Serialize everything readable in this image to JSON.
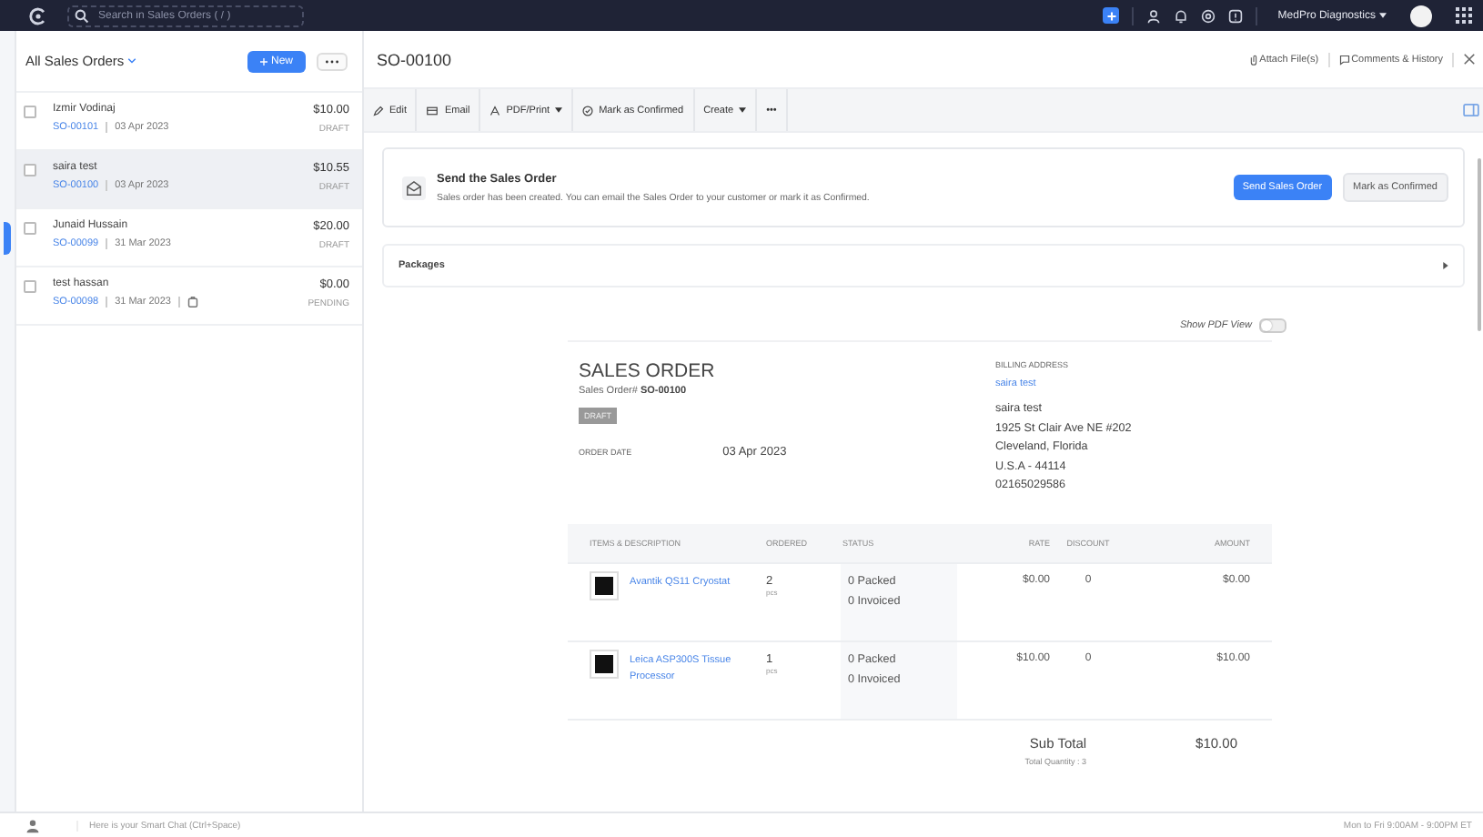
{
  "topbar": {
    "search_placeholder": "Search in Sales Orders ( / )",
    "org": "MedPro Diagnostics"
  },
  "list": {
    "title": "All Sales Orders",
    "new_button": "New",
    "orders": [
      {
        "name": "Izmir Vodinaj",
        "number": "SO-00101",
        "date": "03 Apr 2023",
        "amount": "$10.00",
        "status": "DRAFT",
        "selected": false,
        "attachment": false
      },
      {
        "name": "saira test",
        "number": "SO-00100",
        "date": "03 Apr 2023",
        "amount": "$10.55",
        "status": "DRAFT",
        "selected": true,
        "attachment": false
      },
      {
        "name": "Junaid Hussain",
        "number": "SO-00099",
        "date": "31 Mar 2023",
        "amount": "$20.00",
        "status": "DRAFT",
        "selected": false,
        "attachment": false
      },
      {
        "name": "test hassan",
        "number": "SO-00098",
        "date": "31 Mar 2023",
        "amount": "$0.00",
        "status": "PENDING",
        "selected": false,
        "attachment": true
      }
    ]
  },
  "detail": {
    "title": "SO-00100",
    "attach": "Attach File(s)",
    "comments": "Comments & History",
    "toolbar": [
      {
        "label": "Edit",
        "kind": "edit"
      },
      {
        "label": "Email",
        "kind": "email"
      },
      {
        "label": "PDF/Print",
        "kind": "pdf"
      },
      {
        "label": "Mark as Confirmed",
        "kind": "confirm"
      },
      {
        "label": "Create",
        "kind": "create"
      },
      {
        "label": "•••",
        "kind": "more"
      }
    ],
    "banner": {
      "title": "Send the Sales Order",
      "text": "Sales order has been created. You can email the Sales Order to your customer or mark it as Confirmed.",
      "primary": "Send Sales Order",
      "secondary": "Mark as Confirmed"
    },
    "packages": "Packages",
    "pdf_toggle": {
      "label": "Show PDF View",
      "on": false
    },
    "document": {
      "heading": "SALES ORDER",
      "number_label": "Sales Order#",
      "number": "SO-00100",
      "status": "DRAFT",
      "order_date_label": "ORDER DATE",
      "order_date": "03 Apr 2023",
      "billing_label": "BILLING ADDRESS",
      "billing_link": "saira test",
      "address": [
        "saira test",
        "1925 St Clair Ave NE #202",
        "Cleveland, Florida",
        "U.S.A - 44114",
        "02165029586"
      ],
      "columns": [
        "ITEMS & DESCRIPTION",
        "ORDERED",
        "STATUS",
        "RATE",
        "DISCOUNT",
        "AMOUNT"
      ],
      "rows": [
        {
          "item": "Avantik QS11 Cryostat",
          "ordered": "2",
          "unit": "pcs",
          "packed": "0 Packed",
          "invoiced": "0 Invoiced",
          "rate": "$0.00",
          "discount": "0",
          "amount": "$0.00"
        },
        {
          "item": "Leica ASP300S Tissue Processor",
          "ordered": "1",
          "unit": "pcs",
          "packed": "0 Packed",
          "invoiced": "0 Invoiced",
          "rate": "$10.00",
          "discount": "0",
          "amount": "$10.00"
        }
      ],
      "subtotal_label": "Sub Total",
      "subtotal": "$10.00",
      "total_quantity": "Total Quantity : 3"
    }
  },
  "footer": {
    "chat_placeholder": "Here is your Smart Chat (Ctrl+Space)",
    "hours": "Mon to Fri 9:00AM - 9:00PM ET"
  }
}
